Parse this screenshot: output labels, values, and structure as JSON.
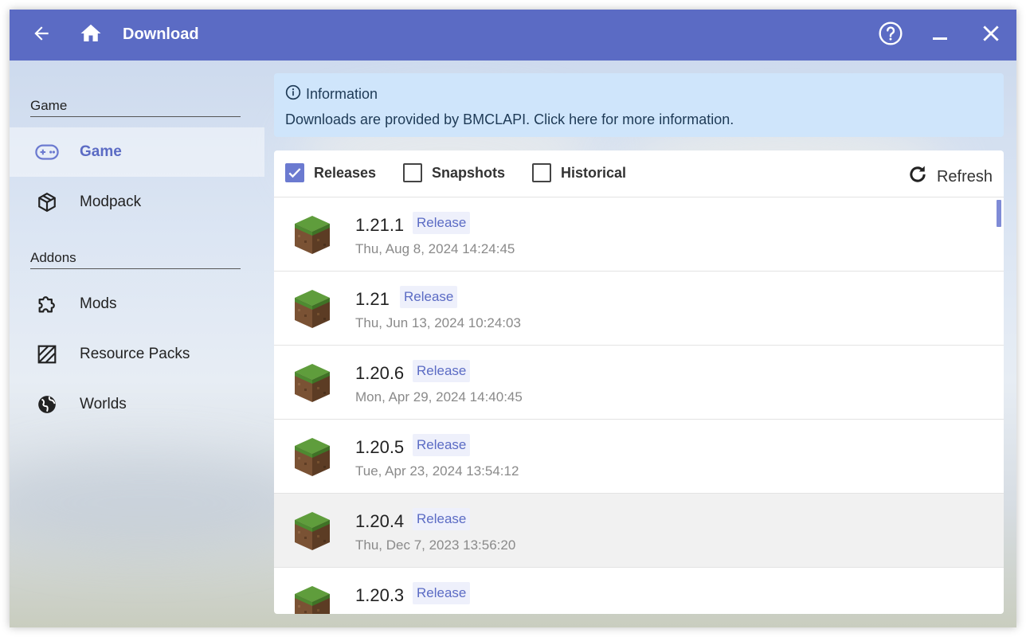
{
  "titlebar": {
    "title": "Download",
    "icons": {
      "back": "arrow-left-icon",
      "home": "home-icon",
      "help": "help-icon",
      "minimize": "minimize-icon",
      "close": "close-icon"
    }
  },
  "colors": {
    "accent": "#5b6bc4",
    "info_bg": "#cfe5fb",
    "tag_bg": "#eef0fb",
    "muted_text": "#8a8a8a"
  },
  "sidebar": {
    "game_section": "Game",
    "addons_section": "Addons",
    "items": [
      {
        "label": "Game",
        "icon": "gamepad-icon",
        "active": true
      },
      {
        "label": "Modpack",
        "icon": "package-icon",
        "active": false
      },
      {
        "label": "Mods",
        "icon": "puzzle-icon",
        "active": false
      },
      {
        "label": "Resource Packs",
        "icon": "texture-icon",
        "active": false
      },
      {
        "label": "Worlds",
        "icon": "globe-icon",
        "active": false
      }
    ]
  },
  "info": {
    "title": "Information",
    "text": "Downloads are provided by BMCLAPI. Click here for more information."
  },
  "filters": {
    "releases": {
      "label": "Releases",
      "checked": true
    },
    "snapshots": {
      "label": "Snapshots",
      "checked": false
    },
    "historical": {
      "label": "Historical",
      "checked": false
    },
    "refresh_label": "Refresh"
  },
  "versions": [
    {
      "version": "1.21.1",
      "type": "Release",
      "date": "Thu, Aug 8, 2024 14:24:45"
    },
    {
      "version": "1.21",
      "type": "Release",
      "date": "Thu, Jun 13, 2024 10:24:03"
    },
    {
      "version": "1.20.6",
      "type": "Release",
      "date": "Mon, Apr 29, 2024 14:40:45"
    },
    {
      "version": "1.20.5",
      "type": "Release",
      "date": "Tue, Apr 23, 2024 13:54:12"
    },
    {
      "version": "1.20.4",
      "type": "Release",
      "date": "Thu, Dec 7, 2023 13:56:20"
    },
    {
      "version": "1.20.3",
      "type": "Release",
      "date": ""
    }
  ]
}
